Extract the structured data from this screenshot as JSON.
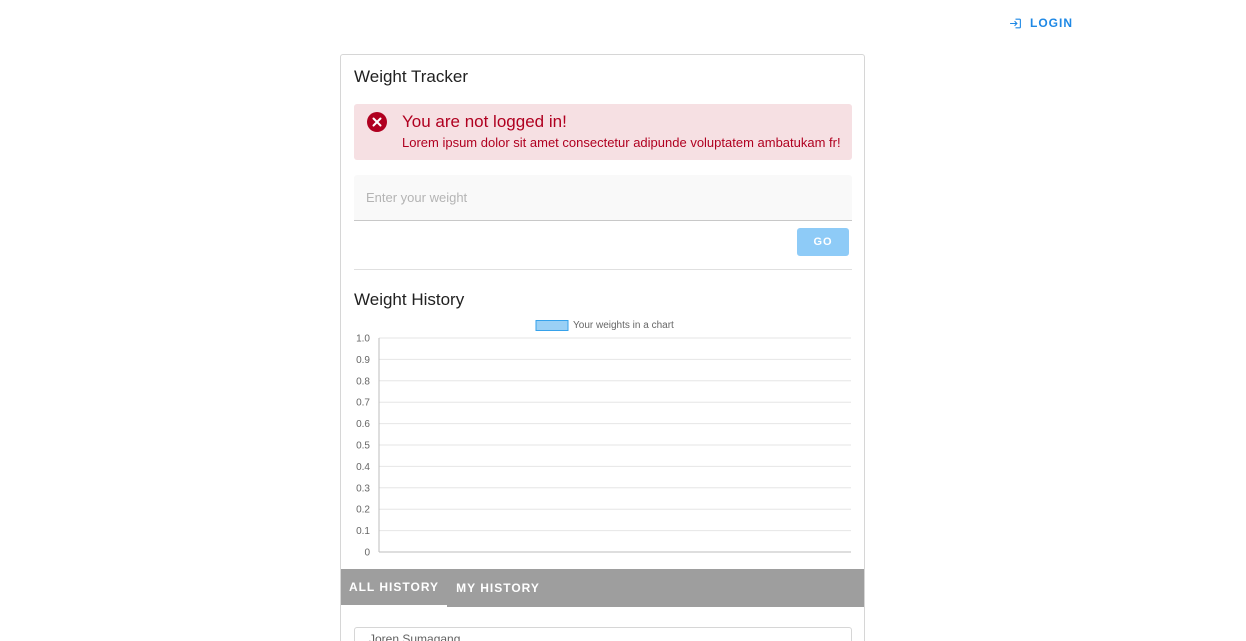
{
  "header": {
    "login_label": "LOGIN"
  },
  "card": {
    "title": "Weight Tracker",
    "alert": {
      "title": "You are not logged in!",
      "message": "Lorem ipsum dolor sit amet consectetur adipunde voluptatem ambatukam fr!"
    },
    "weight_input": {
      "placeholder": "Enter your weight",
      "value": ""
    },
    "go_label": "GO"
  },
  "history": {
    "title": "Weight History",
    "tabs": [
      {
        "label": "ALL HISTORY",
        "active": true
      },
      {
        "label": "MY HISTORY",
        "active": false
      }
    ],
    "items": [
      {
        "name": "Joren Sumagang"
      }
    ]
  },
  "colors": {
    "accent": "#1e88e5",
    "alert_bg": "#f6e0e3",
    "alert_text": "#b00020",
    "go_button": "#8ecbf7",
    "tabs_bg": "#9e9e9e",
    "legend_fill": "#9ad0f5",
    "legend_stroke": "#36a2eb"
  },
  "chart_data": {
    "type": "bar",
    "categories": [],
    "series": [
      {
        "name": "Your weights in a chart",
        "values": []
      }
    ],
    "ylim": [
      0,
      1
    ],
    "yticks": [
      "0",
      "0.1",
      "0.2",
      "0.3",
      "0.4",
      "0.5",
      "0.6",
      "0.7",
      "0.8",
      "0.9",
      "1.0"
    ],
    "grid": true,
    "legend": "top"
  }
}
